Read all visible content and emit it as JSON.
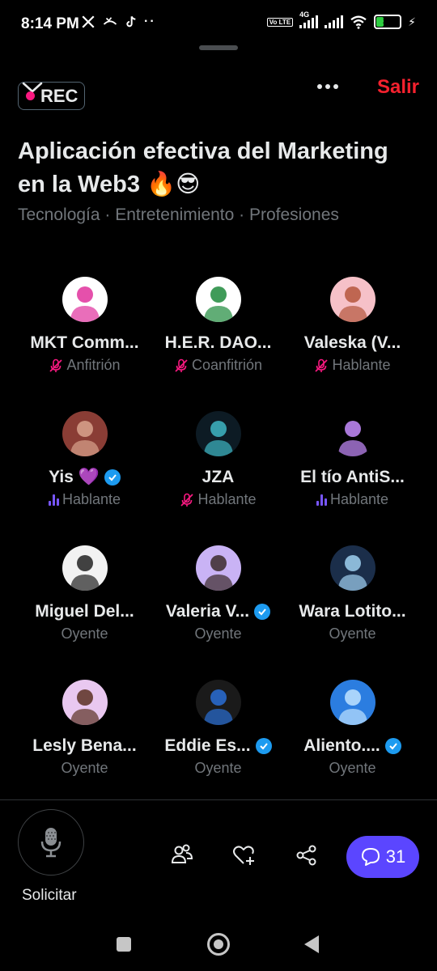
{
  "status_bar": {
    "time": "8:14 PM",
    "left_icons": [
      "x-logo-icon",
      "missed-call-icon",
      "tiktok-icon",
      "more-dots-icon"
    ],
    "network": "4G",
    "volte": "Vo LTE",
    "battery": "32",
    "battery_level": 0.32
  },
  "header": {
    "exit_label": "Salir",
    "rec_label": "REC",
    "title": "Aplicación efectiva del Marketing en la Web3 🔥😎",
    "topics": "Tecnología · Entretenimiento · Profesiones"
  },
  "participants": [
    {
      "name": "MKT Comm...",
      "role": "Anfitrión",
      "role_icon": "mic-off-icon",
      "verified": false,
      "avatar_color": "#ffffff",
      "avatar_accent": "#e0319c"
    },
    {
      "name": "H.E.R. DAO...",
      "role": "Coanfitrión",
      "role_icon": "mic-off-icon",
      "verified": false,
      "avatar_color": "#ffffff",
      "avatar_accent": "#1e8a3c"
    },
    {
      "name": "Valeska (V...",
      "role": "Hablante",
      "role_icon": "mic-off-icon",
      "verified": false,
      "avatar_color": "#f6c1c8",
      "avatar_accent": "#b5563c"
    },
    {
      "name": "Yis 💜",
      "role": "Hablante",
      "role_icon": "speaking-icon",
      "verified": true,
      "avatar_color": "#8a3d35",
      "avatar_accent": "#d9a38d"
    },
    {
      "name": "JZA",
      "role": "Hablante",
      "role_icon": "mic-off-icon",
      "verified": false,
      "avatar_color": "#0d1b24",
      "avatar_accent": "#3fb6c4"
    },
    {
      "name": "El tío AntiS...",
      "role": "Hablante",
      "role_icon": "speaking-icon",
      "verified": false,
      "avatar_color": "#000000",
      "avatar_accent": "#c78dff"
    },
    {
      "name": "Miguel Del...",
      "role": "Oyente",
      "role_icon": "",
      "verified": false,
      "avatar_color": "#f2f2f2",
      "avatar_accent": "#222222"
    },
    {
      "name": "Valeria V...",
      "role": "Oyente",
      "role_icon": "",
      "verified": true,
      "avatar_color": "#c9b3f5",
      "avatar_accent": "#3b2a2a"
    },
    {
      "name": "Wara Lotito...",
      "role": "Oyente",
      "role_icon": "",
      "verified": false,
      "avatar_color": "#1b2e4a",
      "avatar_accent": "#9fd0f0"
    },
    {
      "name": "Lesly Bena...",
      "role": "Oyente",
      "role_icon": "",
      "verified": false,
      "avatar_color": "#e9c8f0",
      "avatar_accent": "#5a3022"
    },
    {
      "name": "Eddie Es...",
      "role": "Oyente",
      "role_icon": "",
      "verified": true,
      "avatar_color": "#1a1a1a",
      "avatar_accent": "#2a6fd6"
    },
    {
      "name": "Aliento....",
      "role": "Oyente",
      "role_icon": "",
      "verified": true,
      "avatar_color": "#2b7de0",
      "avatar_accent": "#bfe3ff"
    }
  ],
  "bottom_bar": {
    "request_label": "Solicitar",
    "chat_count": "31",
    "actions": [
      "people-icon",
      "heart-plus-icon",
      "share-icon"
    ]
  },
  "colors": {
    "exit": "#f4212e",
    "rec_dot": "#f91880",
    "chat_button": "#5b46ff",
    "verified": "#1d9bf0",
    "secondary_text": "#71767b"
  }
}
